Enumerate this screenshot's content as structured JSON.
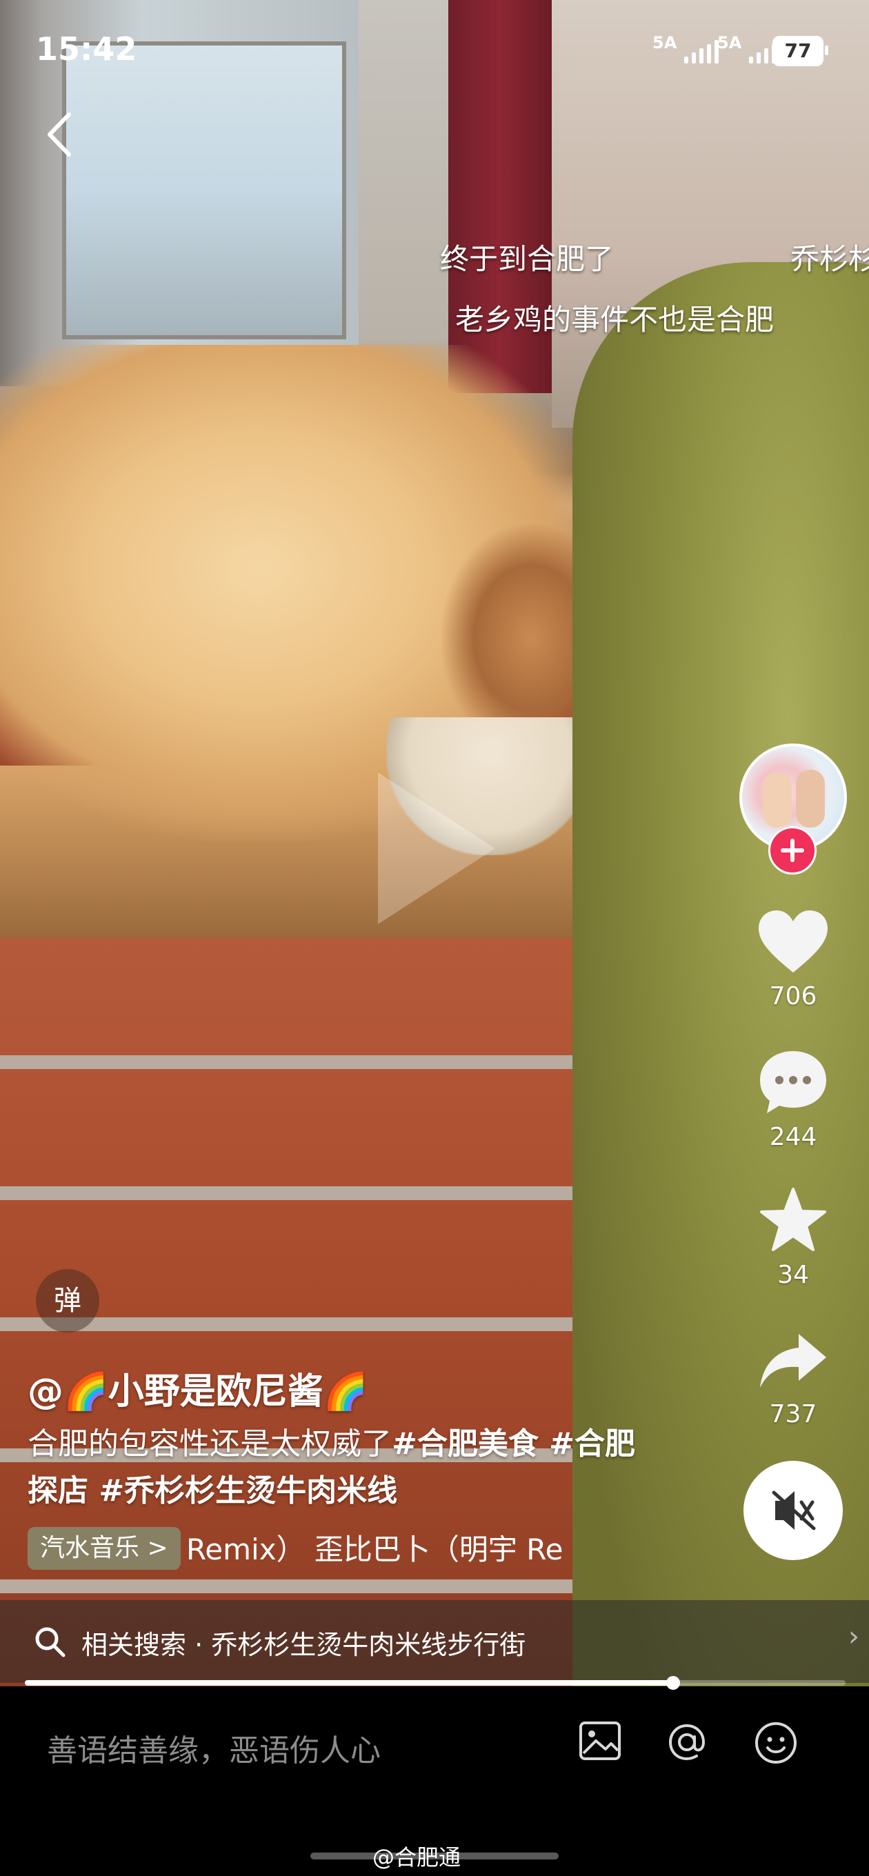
{
  "status_bar": {
    "time": "15:42",
    "signal1": "5A",
    "signal2": "5A",
    "battery": "77"
  },
  "danmaku": [
    {
      "text": "终于到合肥了"
    },
    {
      "text": "乔杉杉"
    },
    {
      "text": "老乡鸡的事件不也是合肥"
    }
  ],
  "rail": {
    "likes": "706",
    "comments": "244",
    "favorites": "34",
    "shares": "737"
  },
  "danmu_toggle": "弹",
  "post": {
    "author": "@🌈小野是欧尼酱🌈",
    "desc_plain": "合肥的包容性还是太权威了",
    "desc_tags": "#合肥美食 #合肥探店 #乔杉杉生烫牛肉米线",
    "music_tag": "汽水音乐 >",
    "music_name": "Remix）  歪比巴卜（明宇 Re"
  },
  "related_search": {
    "text": "相关搜索 · 乔杉杉生烫牛肉米线步行街",
    "arrow": "›"
  },
  "playback": {
    "progress": 0.79
  },
  "comment_bar": {
    "placeholder": "善语结善缘，恶语伤人心"
  },
  "watermark": "@合肥通"
}
